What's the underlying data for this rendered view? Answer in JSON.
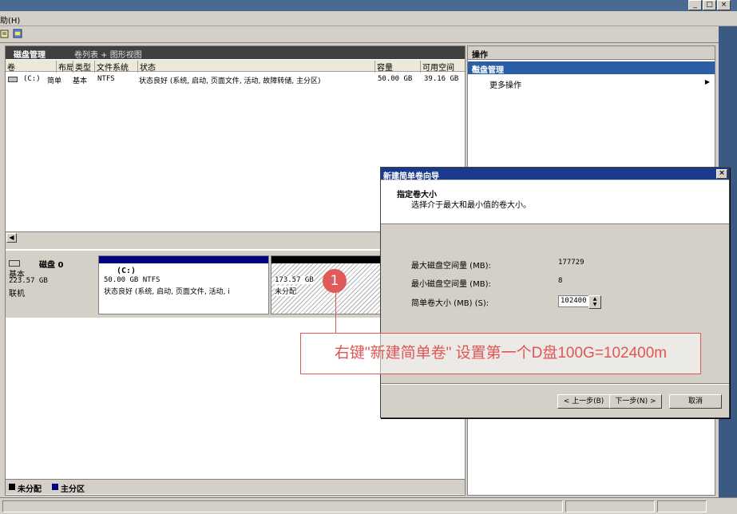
{
  "window": {
    "menu_partial": "助(H)",
    "title_buttons": [
      "_",
      "□",
      "×"
    ]
  },
  "disk_mgmt": {
    "title": "磁盘管理",
    "views": "卷列表 + 图形视图",
    "columns": [
      "卷",
      "布局",
      "类型",
      "文件系统",
      "状态",
      "容量",
      "可用空间"
    ],
    "volumes": [
      {
        "name": "(C:)",
        "layout": "简单",
        "type": "基本",
        "fs": "NTFS",
        "status": "状态良好 (系统, 启动, 页面文件, 活动, 故障转储, 主分区)",
        "capacity": "50.00 GB",
        "free": "39.16 GB"
      }
    ]
  },
  "disk0": {
    "name": "磁盘 0",
    "type": "基本",
    "size": "223.57 GB",
    "state": "联机",
    "partition_c": {
      "label": "(C:)",
      "size": "50.00 GB NTFS",
      "status": "状态良好 (系统, 启动, 页面文件, 活动, i"
    },
    "partition_u": {
      "size": "173.57 GB",
      "status": "未分配"
    }
  },
  "legend": {
    "unallocated": "未分配",
    "primary": "主分区",
    "colors": {
      "unallocated": "#000000",
      "primary": "#000080"
    }
  },
  "actions": {
    "title": "操作",
    "section": "磁盘管理",
    "more": "更多操作"
  },
  "wizard": {
    "title": "新建简单卷向导",
    "heading": "指定卷大小",
    "subheading": "选择介于最大和最小值的卷大小。",
    "max_label": "最大磁盘空间量 (MB):",
    "max_value": "177729",
    "min_label": "最小磁盘空间量 (MB):",
    "min_value": "8",
    "size_label": "简单卷大小 (MB) (S):",
    "size_value": "102400",
    "back_btn": "< 上一步(B)",
    "next_btn": "下一步(N) >",
    "cancel_btn": "取消"
  },
  "annotation": {
    "number": "1",
    "text": "右键\"新建简单卷\" 设置第一个D盘100G=102400m",
    "color": "#e05555"
  }
}
